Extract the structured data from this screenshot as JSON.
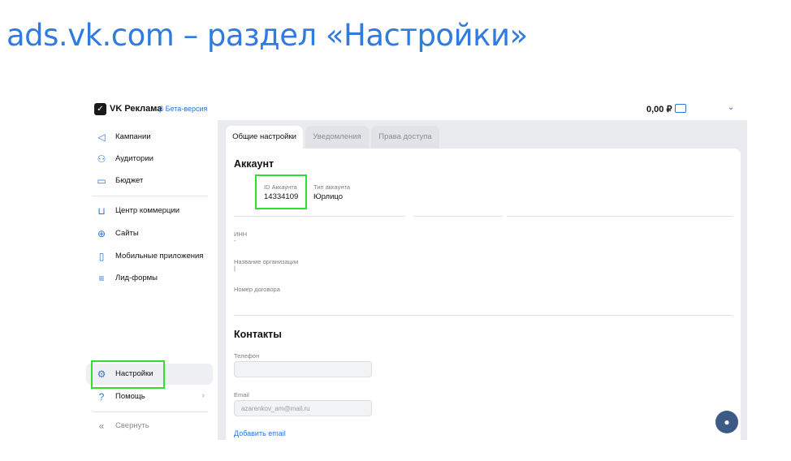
{
  "slide": {
    "title": "ads.vk.com – раздел «Настройки»"
  },
  "topbar": {
    "logo_icon": "vk-ads-logo-icon",
    "brand": "VK Реклама",
    "beta": "β Бета-версия",
    "balance": "0,00 ₽",
    "chevron": "⌄"
  },
  "sidebar": {
    "items": [
      {
        "label": "Кампании",
        "icon": "megaphone-icon",
        "glyph": "◁"
      },
      {
        "label": "Аудитории",
        "icon": "users-icon",
        "glyph": "⚇"
      },
      {
        "label": "Бюджет",
        "icon": "wallet-icon",
        "glyph": "▭"
      },
      {
        "label": "Центр коммерции",
        "icon": "cart-icon",
        "glyph": "⊔"
      },
      {
        "label": "Сайты",
        "icon": "globe-icon",
        "glyph": "⊕"
      },
      {
        "label": "Мобильные приложения",
        "icon": "phone-icon",
        "glyph": "▯"
      },
      {
        "label": "Лид-формы",
        "icon": "form-icon",
        "glyph": "≡"
      }
    ],
    "settings": {
      "label": "Настройки",
      "icon": "gear-icon",
      "glyph": "⚙"
    },
    "help": {
      "label": "Помощь",
      "icon": "question-icon",
      "glyph": "?",
      "arrow": "›"
    },
    "collapse": {
      "label": "Свернуть",
      "icon": "collapse-icon",
      "glyph": "«"
    }
  },
  "tabs": [
    {
      "label": "Общие настройки",
      "active": true
    },
    {
      "label": "Уведомления",
      "active": false
    },
    {
      "label": "Права доступа",
      "active": false
    }
  ],
  "account": {
    "heading": "Аккаунт",
    "id_label": "ID Аккаунта",
    "id_value": "14334109",
    "type_label": "Тип аккаунта",
    "type_value": "Юрлицо",
    "inn_label": "ИНН",
    "inn_value": "-",
    "org_label": "Название организации",
    "org_value": "|",
    "contract_label": "Номер договора"
  },
  "contacts": {
    "heading": "Контакты",
    "phone_label": "Телефон",
    "phone_value": "",
    "email_label": "Email",
    "email_value": "azarenkov_am@mail.ru",
    "add_email": "Добавить email"
  },
  "chat": {
    "icon": "chat-bubble-icon",
    "glyph": "●"
  },
  "colors": {
    "accent": "#2b74d8",
    "title": "#2f7be0",
    "highlight": "#2fe02f"
  }
}
